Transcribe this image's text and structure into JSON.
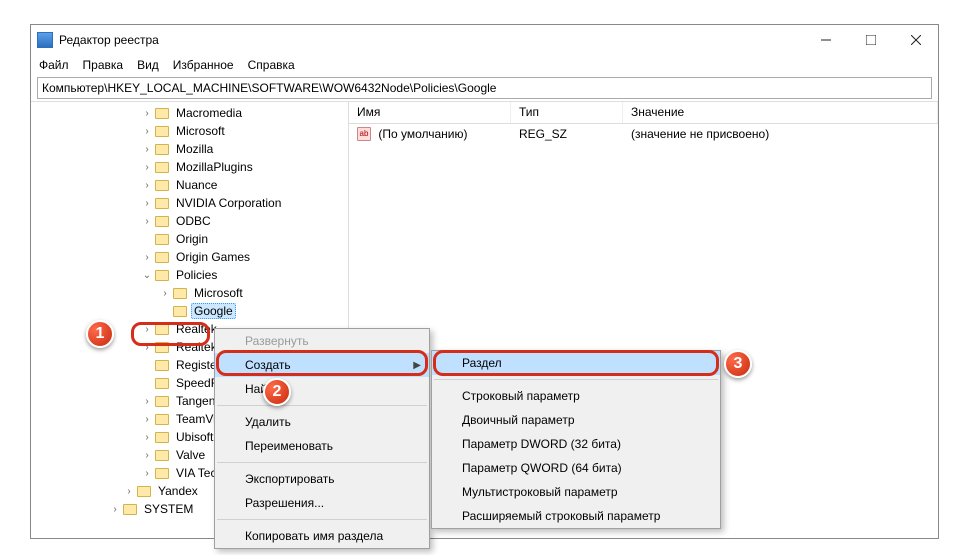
{
  "window": {
    "title": "Редактор реестра",
    "buttons": {
      "min": "minimize",
      "max": "maximize",
      "close": "close"
    }
  },
  "menu": {
    "file": "Файл",
    "edit": "Правка",
    "view": "Вид",
    "favorites": "Избранное",
    "help": "Справка"
  },
  "address": "Компьютер\\HKEY_LOCAL_MACHINE\\SOFTWARE\\WOW6432Node\\Policies\\Google",
  "tree": {
    "items": [
      {
        "label": "Macromedia",
        "indent": 110,
        "chev": "›"
      },
      {
        "label": "Microsoft",
        "indent": 110,
        "chev": "›"
      },
      {
        "label": "Mozilla",
        "indent": 110,
        "chev": "›"
      },
      {
        "label": "MozillaPlugins",
        "indent": 110,
        "chev": "›"
      },
      {
        "label": "Nuance",
        "indent": 110,
        "chev": "›"
      },
      {
        "label": "NVIDIA Corporation",
        "indent": 110,
        "chev": "›"
      },
      {
        "label": "ODBC",
        "indent": 110,
        "chev": "›"
      },
      {
        "label": "Origin",
        "indent": 110,
        "chev": ""
      },
      {
        "label": "Origin Games",
        "indent": 110,
        "chev": "›"
      },
      {
        "label": "Policies",
        "indent": 110,
        "chev": "v"
      },
      {
        "label": "Microsoft",
        "indent": 128,
        "chev": "›",
        "cut": true
      },
      {
        "label": "Google",
        "indent": 128,
        "chev": "",
        "selected": true
      },
      {
        "label": "Realtek",
        "indent": 110,
        "chev": "›"
      },
      {
        "label": "Realtek Semiconductor Corp.",
        "indent": 110,
        "chev": "›"
      },
      {
        "label": "RegisteredApplications",
        "indent": 110,
        "chev": ""
      },
      {
        "label": "SpeedFan",
        "indent": 110,
        "chev": "",
        "cut": true
      },
      {
        "label": "Tangentix",
        "indent": 110,
        "chev": "›"
      },
      {
        "label": "TeamViewer",
        "indent": 110,
        "chev": "›"
      },
      {
        "label": "Ubisoft",
        "indent": 110,
        "chev": "›"
      },
      {
        "label": "Valve",
        "indent": 110,
        "chev": "›"
      },
      {
        "label": "VIA Technologies, Inc.",
        "indent": 110,
        "chev": "›"
      },
      {
        "label": "Yandex",
        "indent": 92,
        "chev": "›"
      },
      {
        "label": "SYSTEM",
        "indent": 78,
        "chev": "›"
      }
    ]
  },
  "list": {
    "headers": {
      "name": "Имя",
      "type": "Тип",
      "value": "Значение"
    },
    "rows": [
      {
        "name": "(По умолчанию)",
        "type": "REG_SZ",
        "value": "(значение не присвоено)"
      }
    ]
  },
  "context1": {
    "expand": "Развернуть",
    "createLabel": "Создать",
    "find": "Найти...",
    "delete": "Удалить",
    "rename": "Переименовать",
    "export": "Экспортировать",
    "perms": "Разрешения...",
    "copyname": "Копировать имя раздела"
  },
  "context2": {
    "key": "Раздел",
    "string": "Строковый параметр",
    "binary": "Двоичный параметр",
    "dword": "Параметр DWORD (32 бита)",
    "qword": "Параметр QWORD (64 бита)",
    "multi": "Мультистроковый параметр",
    "expand": "Расширяемый строковый параметр"
  },
  "callouts": {
    "c1": "1",
    "c2": "2",
    "c3": "3"
  }
}
